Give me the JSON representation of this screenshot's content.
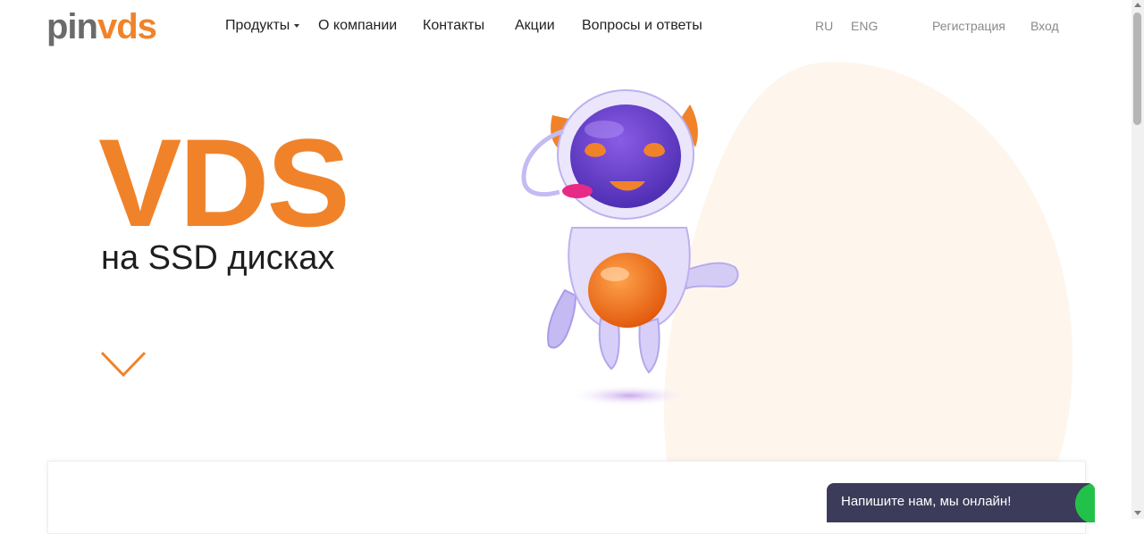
{
  "logo": {
    "part1": "pin",
    "part2": "vds"
  },
  "nav": {
    "products": "Продукты",
    "about": "О компании",
    "contacts": "Контакты",
    "promotions": "Акции",
    "faq": "Вопросы и ответы"
  },
  "lang": {
    "ru": "RU",
    "en": "ENG"
  },
  "auth": {
    "register": "Регистрация",
    "login": "Вход"
  },
  "hero": {
    "title": "VDS",
    "subtitle": "на SSD дисках"
  },
  "chat": {
    "text": "Напишите нам, мы онлайн!"
  },
  "colors": {
    "accent": "#f0832a",
    "blob": "#fef5ec",
    "chat_bg": "#3c3b5a",
    "online": "#22c24a"
  },
  "icons": {
    "scroll_down": "chevron-down-icon",
    "products_caret": "caret-down-icon",
    "mascot": "robot-mascot"
  }
}
